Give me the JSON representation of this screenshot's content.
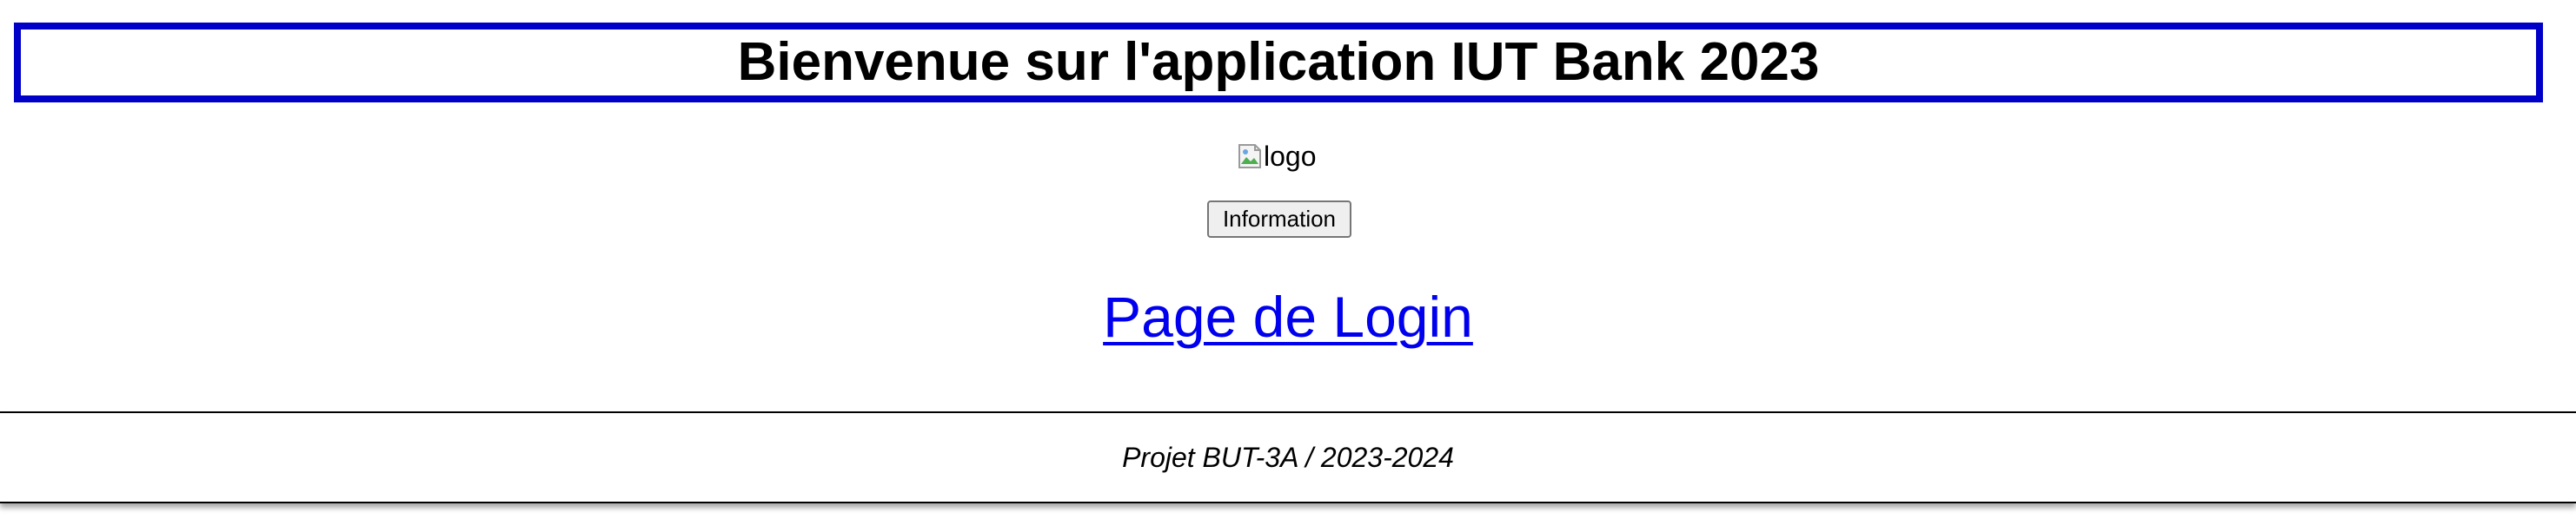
{
  "header": {
    "title": "Bienvenue sur l'application IUT Bank 2023",
    "border_color": "#0000c8"
  },
  "logo": {
    "alt_text": "logo",
    "icon": "broken-image-icon"
  },
  "info_button": {
    "label": "Information"
  },
  "login_link": {
    "label": "Page de Login",
    "color": "#0000ee"
  },
  "footer": {
    "text": "Projet BUT-3A / 2023-2024"
  }
}
